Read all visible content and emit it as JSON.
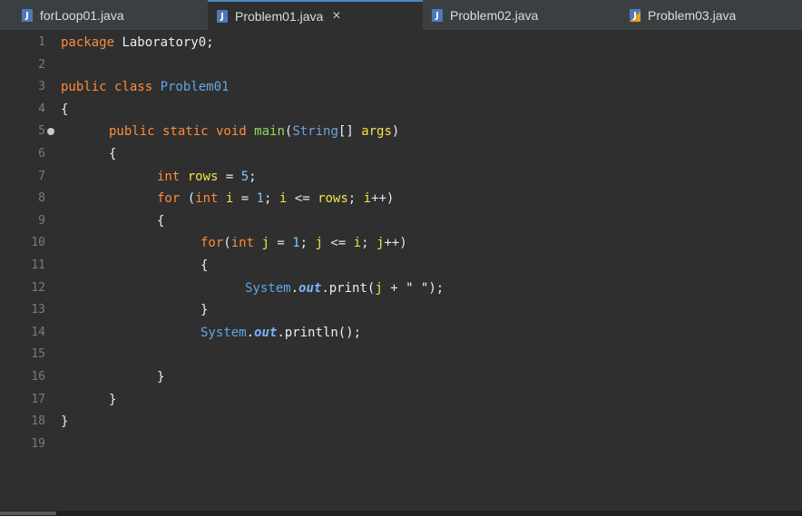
{
  "tabs": [
    {
      "label": "forLoop01.java",
      "icon": "java-file-icon",
      "active": false
    },
    {
      "label": "Problem01.java",
      "icon": "java-file-icon",
      "active": true,
      "close": "×"
    },
    {
      "label": "Problem02.java",
      "icon": "java-file-icon",
      "active": false
    },
    {
      "label": "Problem03.java",
      "icon": "java-file-warning-icon",
      "active": false
    }
  ],
  "editor": {
    "lines": [
      {
        "n": "1"
      },
      {
        "n": "2"
      },
      {
        "n": "3"
      },
      {
        "n": "4"
      },
      {
        "n": "5"
      },
      {
        "n": "6"
      },
      {
        "n": "7"
      },
      {
        "n": "8"
      },
      {
        "n": "9"
      },
      {
        "n": "10"
      },
      {
        "n": "11"
      },
      {
        "n": "12"
      },
      {
        "n": "13"
      },
      {
        "n": "14"
      },
      {
        "n": "15"
      },
      {
        "n": "16"
      },
      {
        "n": "17"
      },
      {
        "n": "18"
      },
      {
        "n": "19"
      }
    ],
    "code": {
      "l1_kw": "package",
      "l1_pkg": " Laboratory0;",
      "l3_kw": "public class ",
      "l3_cls": "Problem01",
      "l4": "{",
      "l5_kw": "public static void ",
      "l5_fn": "main",
      "l5_p1": "(",
      "l5_type": "String",
      "l5_p2": "[] ",
      "l5_var": "args",
      "l5_p3": ")",
      "l6": "{",
      "l7_kw": "int ",
      "l7_var": "rows",
      "l7_op": " = ",
      "l7_num": "5",
      "l7_semi": ";",
      "l8_kw": "for ",
      "l8_p1": "(",
      "l8_kw2": "int ",
      "l8_var": "i",
      "l8_op": " = ",
      "l8_num": "1",
      "l8_semi": "; ",
      "l8_var2": "i",
      "l8_op2": " <= ",
      "l8_var3": "rows",
      "l8_semi2": "; ",
      "l8_var4": "i",
      "l8_op3": "++)",
      "l9": "{",
      "l10_kw": "for",
      "l10_p1": "(",
      "l10_kw2": "int ",
      "l10_var": "j",
      "l10_op": " = ",
      "l10_num": "1",
      "l10_semi": "; ",
      "l10_var2": "j",
      "l10_op2": " <= ",
      "l10_var3": "i",
      "l10_semi2": "; ",
      "l10_var4": "j",
      "l10_op3": "++)",
      "l11": "{",
      "l12_cls": "System",
      "l12_dot": ".",
      "l12_field": "out",
      "l12_call": ".print(",
      "l12_var": "j",
      "l12_op": " + ",
      "l12_str": "\" \"",
      "l12_end": ");",
      "l13": "}",
      "l14_cls": "System",
      "l14_dot": ".",
      "l14_field": "out",
      "l14_call": ".println();",
      "l16": "}",
      "l17": "}",
      "l18": "}"
    }
  },
  "colors": {
    "background": "#2f2f2f",
    "keyword": "#ff8c3a",
    "class": "#5ea7e6",
    "method": "#8fdc5d",
    "variable": "#f4e34a",
    "number": "#7ec7f5",
    "line_number": "#7a7a7a"
  }
}
